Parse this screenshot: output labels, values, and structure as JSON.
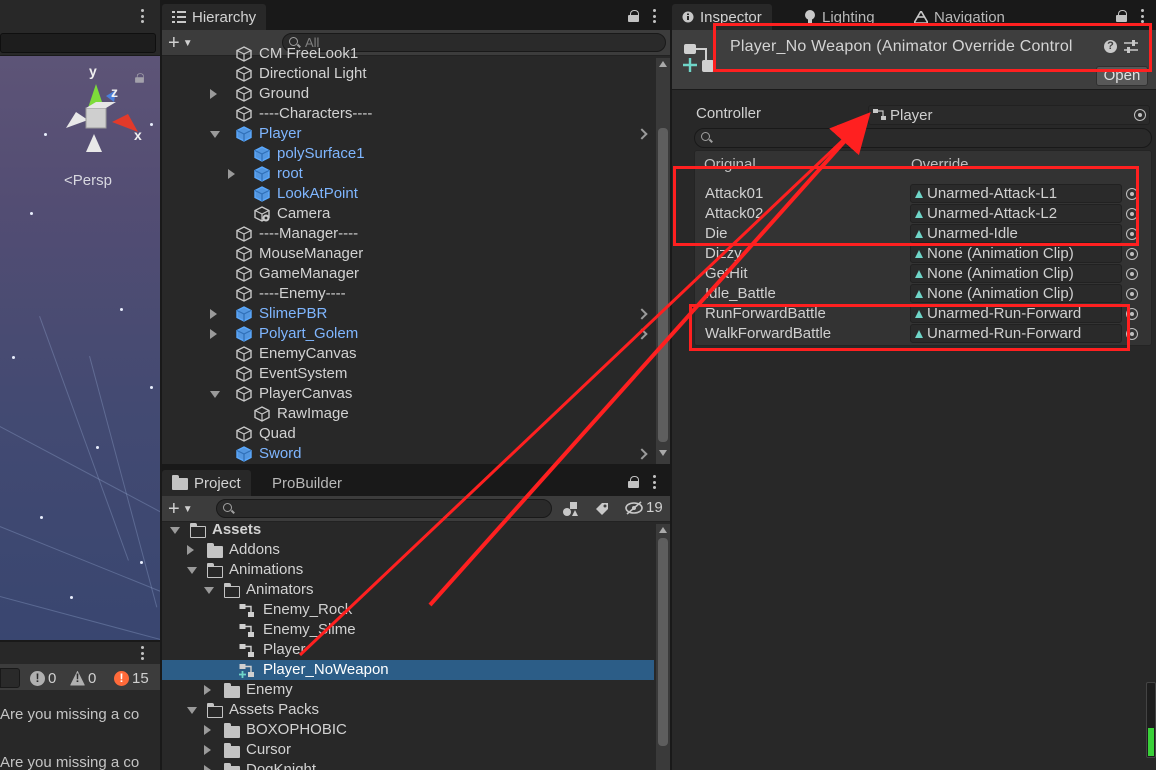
{
  "scene": {
    "persp_label": "<Persp",
    "gizmo": {
      "y": "y",
      "z": "z",
      "x": "x"
    }
  },
  "console": {
    "counts": {
      "info": "0",
      "warn": "0",
      "error": "15"
    },
    "lines": [
      "Are you missing a co",
      "Are you missing a co"
    ]
  },
  "hierarchy": {
    "tab_label": "Hierarchy",
    "search_placeholder": "All",
    "items": [
      {
        "label": "CM FreeLook1",
        "indent": 0,
        "fold": "none",
        "blue": false
      },
      {
        "label": "Directional Light",
        "indent": 0,
        "fold": "none",
        "blue": false
      },
      {
        "label": "Ground",
        "indent": 0,
        "fold": "closed",
        "blue": false
      },
      {
        "label": "----Characters----",
        "indent": 0,
        "fold": "none",
        "blue": false
      },
      {
        "label": "Player",
        "indent": 0,
        "fold": "open",
        "blue": true,
        "chev": true
      },
      {
        "label": "polySurface1",
        "indent": 1,
        "fold": "none",
        "blue": true
      },
      {
        "label": "root",
        "indent": 1,
        "fold": "closed",
        "blue": true
      },
      {
        "label": "LookAtPoint",
        "indent": 1,
        "fold": "none",
        "blue": true
      },
      {
        "label": "Camera",
        "indent": 1,
        "fold": "none",
        "blue": false,
        "camera": true
      },
      {
        "label": "----Manager----",
        "indent": 0,
        "fold": "none",
        "blue": false
      },
      {
        "label": "MouseManager",
        "indent": 0,
        "fold": "none",
        "blue": false
      },
      {
        "label": "GameManager",
        "indent": 0,
        "fold": "none",
        "blue": false
      },
      {
        "label": "----Enemy----",
        "indent": 0,
        "fold": "none",
        "blue": false
      },
      {
        "label": "SlimePBR",
        "indent": 0,
        "fold": "closed",
        "blue": true,
        "chev": true
      },
      {
        "label": "Polyart_Golem",
        "indent": 0,
        "fold": "closed",
        "blue": true,
        "chev": true
      },
      {
        "label": "EnemyCanvas",
        "indent": 0,
        "fold": "none",
        "blue": false
      },
      {
        "label": "EventSystem",
        "indent": 0,
        "fold": "none",
        "blue": false
      },
      {
        "label": "PlayerCanvas",
        "indent": 0,
        "fold": "open",
        "blue": false
      },
      {
        "label": "RawImage",
        "indent": 1,
        "fold": "none",
        "blue": false
      },
      {
        "label": "Quad",
        "indent": 0,
        "fold": "none",
        "blue": false
      },
      {
        "label": "Sword",
        "indent": 0,
        "fold": "none",
        "blue": true,
        "chev": true
      }
    ]
  },
  "project": {
    "tabs": [
      "Project",
      "ProBuilder"
    ],
    "hidden_count": "19",
    "items": [
      {
        "label": "Assets",
        "indent": 0,
        "fold": "open",
        "kind": "folder-open",
        "bold": true
      },
      {
        "label": "Addons",
        "indent": 1,
        "fold": "closed",
        "kind": "folder"
      },
      {
        "label": "Animations",
        "indent": 1,
        "fold": "open",
        "kind": "folder-open"
      },
      {
        "label": "Animators",
        "indent": 2,
        "fold": "open",
        "kind": "folder-open"
      },
      {
        "label": "Enemy_Rock",
        "indent": 3,
        "fold": "none",
        "kind": "controller"
      },
      {
        "label": "Enemy_Slime",
        "indent": 3,
        "fold": "none",
        "kind": "controller"
      },
      {
        "label": "Player",
        "indent": 3,
        "fold": "none",
        "kind": "controller"
      },
      {
        "label": "Player_NoWeapon",
        "indent": 3,
        "fold": "none",
        "kind": "override",
        "selected": true
      },
      {
        "label": "Enemy",
        "indent": 2,
        "fold": "closed",
        "kind": "folder"
      },
      {
        "label": "Assets Packs",
        "indent": 1,
        "fold": "open",
        "kind": "folder-open"
      },
      {
        "label": "BOXOPHOBIC",
        "indent": 2,
        "fold": "closed",
        "kind": "folder"
      },
      {
        "label": "Cursor",
        "indent": 2,
        "fold": "closed",
        "kind": "folder"
      },
      {
        "label": "DogKnight",
        "indent": 2,
        "fold": "closed",
        "kind": "folder"
      }
    ]
  },
  "inspector": {
    "tabs": [
      "Inspector",
      "Lighting",
      "Navigation"
    ],
    "title": "Player_No Weapon (Animator Override Control",
    "open_label": "Open",
    "controller_label": "Controller",
    "controller_value": "Player",
    "col_original": "Original",
    "col_override": "Override",
    "overrides": [
      {
        "original": "Attack01",
        "override": "Unarmed-Attack-L1"
      },
      {
        "original": "Attack02",
        "override": "Unarmed-Attack-L2"
      },
      {
        "original": "Die",
        "override": "Unarmed-Idle"
      },
      {
        "original": "Dizzy",
        "override": "None (Animation Clip)"
      },
      {
        "original": "GetHit",
        "override": "None (Animation Clip)"
      },
      {
        "original": "Idle_Battle",
        "override": "None (Animation Clip)"
      },
      {
        "original": "RunForwardBattle",
        "override": "Unarmed-Run-Forward"
      },
      {
        "original": "WalkForwardBattle",
        "override": "Unarmed-Run-Forward"
      }
    ]
  },
  "colors": {
    "annotation": "#ff2020",
    "selection": "#2c5d87",
    "prefab_blue": "#7fb6ff"
  }
}
